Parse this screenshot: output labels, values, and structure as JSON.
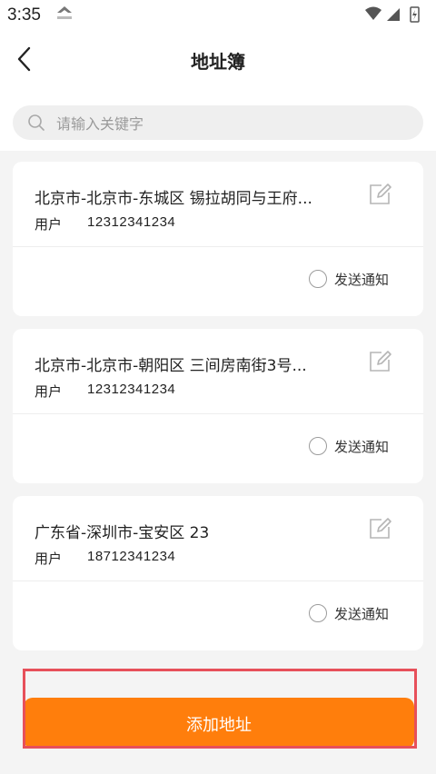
{
  "status_bar": {
    "time": "3:35"
  },
  "header": {
    "title": "地址簿"
  },
  "search": {
    "placeholder": "请输入关键字"
  },
  "addresses": [
    {
      "address": "北京市-北京市-东城区 锡拉胡同与王府...",
      "name": "用户",
      "phone": "12312341234",
      "notify_label": "发送通知"
    },
    {
      "address": "北京市-北京市-朝阳区 三间房南街3号...",
      "name": "用户",
      "phone": "12312341234",
      "notify_label": "发送通知"
    },
    {
      "address": "广东省-深圳市-宝安区 23",
      "name": "用户",
      "phone": "18712341234",
      "notify_label": "发送通知"
    }
  ],
  "footer": {
    "add_label": "添加地址"
  },
  "colors": {
    "accent": "#ff7e0c",
    "highlight": "#e7505a"
  }
}
